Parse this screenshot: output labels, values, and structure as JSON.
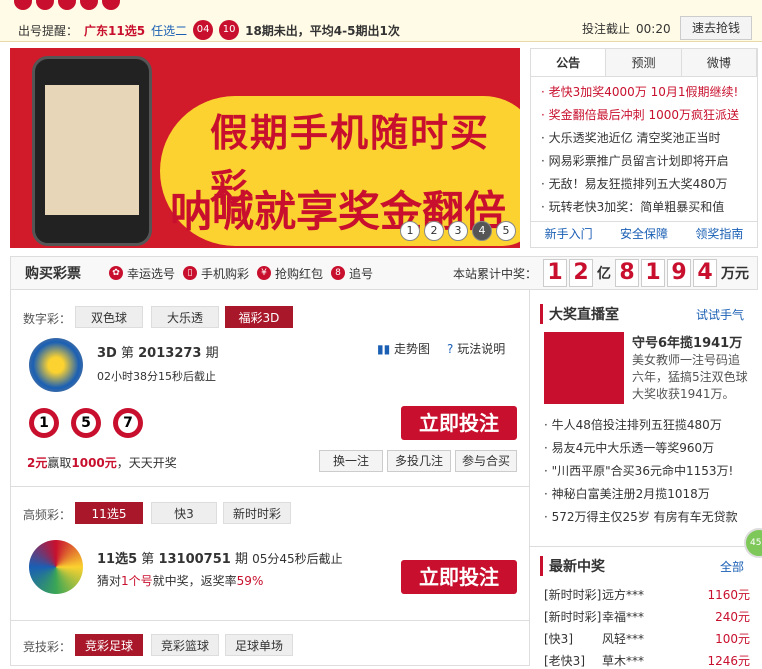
{
  "topbar": {
    "draw_label": "出号提醒：",
    "lottery": "广东11选5",
    "option": "任选二",
    "balls": [
      "04",
      "10"
    ],
    "missing": "18期未出，平均4-5期出1次",
    "deadline_label": "投注截止",
    "deadline_time": "00:20",
    "quick_button": "速去抢钱"
  },
  "banner": {
    "line1": "假期手机随时买彩",
    "line2": "呐喊就享奖金翻倍",
    "dots": [
      "1",
      "2",
      "3",
      "4",
      "5"
    ]
  },
  "notice": {
    "tabs": [
      "公告",
      "预测",
      "微博"
    ],
    "items": [
      "老快3加奖4000万 10月1假期继续!",
      "奖金翻倍最后冲刺 1000万疯狂派送",
      "大乐透奖池近亿 清空奖池正当时",
      "网易彩票推广员留言计划即将开启",
      "无敌！易友狂揽排列五大奖480万",
      "玩转老快3加奖：简单粗暴买和值"
    ],
    "footer": [
      "新手入门",
      "安全保障",
      "领奖指南"
    ]
  },
  "buybar": {
    "title": "购买彩票",
    "links": [
      "幸运选号",
      "手机购彩",
      "抢购红包",
      "追号"
    ],
    "total_label": "本站累计中奖：",
    "digits": [
      "1",
      "2",
      "8",
      "1",
      "9",
      "4"
    ],
    "unit1": "亿",
    "unit2": "万元"
  },
  "digital": {
    "label": "数字彩：",
    "tabs": [
      "双色球",
      "大乐透",
      "福彩3D"
    ],
    "name": "3D",
    "issue_prefix": "第",
    "issue": "2013273",
    "issue_suffix": "期",
    "countdown": "02小时38分15秒后截止",
    "trend": "走势图",
    "rules": "玩法说明",
    "balls": [
      "1",
      "5",
      "7"
    ],
    "bet": "立即投注",
    "prize_a": "2元",
    "prize_b": "赢取",
    "prize_c": "1000元",
    "prize_d": "，天天开奖",
    "actions": [
      "换一注",
      "多投几注",
      "参与合买"
    ]
  },
  "high": {
    "label": "高频彩：",
    "tabs": [
      "11选5",
      "快3",
      "新时时彩"
    ],
    "name": "11选5",
    "issue_prefix": "第",
    "issue": "13100751",
    "issue_suffix": "期",
    "countdown": "05分45秒后截止",
    "desc_a": "猜对",
    "desc_b": "1个号",
    "desc_c": "就中奖，返奖率",
    "desc_d": "59%",
    "bet": "立即投注"
  },
  "sport": {
    "label": "竞技彩：",
    "tabs": [
      "竞彩足球",
      "竞彩篮球",
      "足球单场"
    ]
  },
  "live": {
    "title": "大奖直播室",
    "try": "试试手气",
    "headline": "守号6年揽1941万",
    "desc": "美女教师一注号码追六年，猛搞5注双色球大奖收获1941万。",
    "items": [
      "牛人48倍投注排列五狂揽480万",
      "易友4元中大乐透一等奖960万",
      "\"川西平原\"合买36元命中1153万!",
      "神秘白富美注册2月揽1018万",
      "572万得主仅25岁 有房有车无贷款"
    ]
  },
  "latest": {
    "title": "最新中奖",
    "all": "全部",
    "rows": [
      [
        "[新时时彩]",
        "远方***",
        "1160元"
      ],
      [
        "[新时时彩]",
        "幸福***",
        "240元"
      ],
      [
        "[快3]",
        "风轻***",
        "100元"
      ],
      [
        "[老快3]",
        "草木***",
        "1246元"
      ]
    ]
  },
  "float_pct": "45"
}
